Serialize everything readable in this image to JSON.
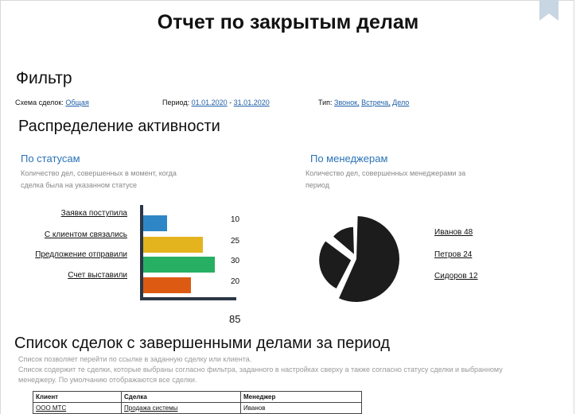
{
  "title": "Отчет по закрытым делам",
  "filter": {
    "title": "Фильтр",
    "scheme_label": "Схема сделок:",
    "scheme_value": "Общая",
    "period_label": "Период:",
    "period_from": "01.01.2020",
    "period_sep": "-",
    "period_to": "31.01.2020",
    "type_label": "Тип:",
    "types": [
      "Звонок,",
      "Встреча,",
      "Дело"
    ]
  },
  "activity": {
    "title": "Распределение активности",
    "by_status": {
      "title": "По статусам",
      "description_line1": "Количество дел, совершенных в момент, когда",
      "description_line2": "сделка была на указанном статусе",
      "total": "85"
    },
    "by_manager": {
      "title": "По менеджерам",
      "description_line1": "Количество дел, совершенных менеджерами за",
      "description_line2": "период"
    }
  },
  "chart_data": [
    {
      "type": "bar",
      "orientation": "horizontal",
      "categories": [
        "Заявка поступила",
        "С клиентом связались",
        "Предложение отправили",
        "Счет выставили"
      ],
      "values": [
        10,
        25,
        30,
        20
      ],
      "colors": [
        "#2f86c6",
        "#e4b41e",
        "#27b063",
        "#dd5a13"
      ],
      "xlim": [
        0,
        35
      ],
      "total": 85
    },
    {
      "type": "pie",
      "categories": [
        "Иванов",
        "Петров",
        "Сидоров"
      ],
      "values": [
        48,
        24,
        12
      ],
      "labels": [
        "Иванов 48",
        "Петров 24",
        "Сидоров 12"
      ],
      "color": "#1c1c1c"
    }
  ],
  "deals": {
    "title": "Список сделок с завершенными делами за период",
    "note_line1": "Список позволяет перейти по ссылке в заданную сделку или клиента.",
    "note_line2": "Список содержит те сделки, которые выбраны согласно фильтра, заданного в настройках сверху а также согласно статусу сделки и выбранному",
    "note_line3": "менеджеру. По умолчанию отображаются все сделки.",
    "columns": [
      "Клиент",
      "Сделка",
      "Менеджер"
    ],
    "rows": [
      [
        "ООО МТС",
        "Продажа системы",
        "Иванов"
      ]
    ]
  }
}
